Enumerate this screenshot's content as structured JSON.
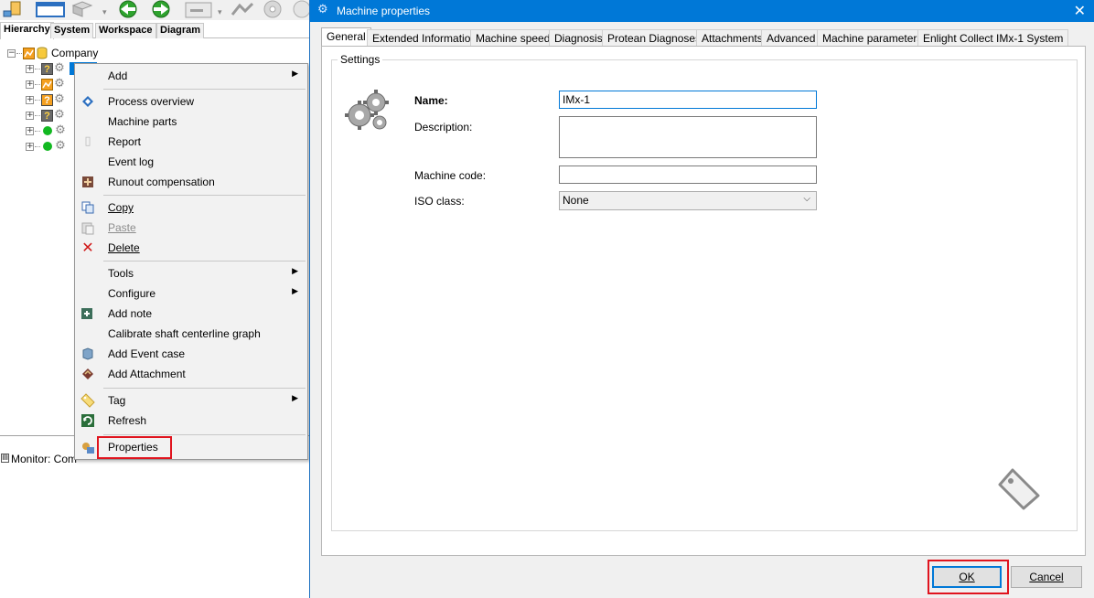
{
  "left_app": {
    "tabs": [
      "Hierarchy",
      "System",
      "Workspace",
      "Diagram"
    ],
    "tree": {
      "root_label": "Company",
      "selected_label": ""
    },
    "bottom": {
      "monitor_label": "Monitor: Com"
    }
  },
  "context_menu": {
    "items": {
      "add": "Add",
      "process_overview": "Process overview",
      "machine_parts": "Machine parts",
      "report": "Report",
      "event_log": "Event log",
      "runout_compensation": "Runout compensation",
      "copy": "Copy",
      "paste": "Paste",
      "delete": "Delete",
      "tools": "Tools",
      "configure": "Configure",
      "add_note": "Add note",
      "calibrate": "Calibrate shaft centerline graph",
      "add_event_case": "Add Event case",
      "add_attachment": "Add Attachment",
      "tag": "Tag",
      "refresh": "Refresh",
      "properties": "Properties"
    }
  },
  "dialog": {
    "title": "Machine properties",
    "tabs": {
      "general": "General",
      "extended": "Extended Information",
      "speed": "Machine speed",
      "diagnosis": "Diagnosis",
      "protean": "Protean Diagnoses",
      "attachments": "Attachments",
      "advanced": "Advanced",
      "params": "Machine parameters",
      "enlight": "Enlight Collect IMx-1 System"
    },
    "settings": {
      "legend": "Settings",
      "name_label": "Name:",
      "name_value": "IMx-1",
      "description_label": "Description:",
      "description_value": "",
      "machine_code_label": "Machine code:",
      "machine_code_value": "",
      "iso_class_label": "ISO class:",
      "iso_class_value": "None"
    },
    "buttons": {
      "ok": "OK",
      "cancel": "Cancel"
    }
  },
  "colors": {
    "titlebar": "#0078d7",
    "highlight": "#e0141e",
    "status_green": "#12b821",
    "status_orange": "#f5a020"
  }
}
